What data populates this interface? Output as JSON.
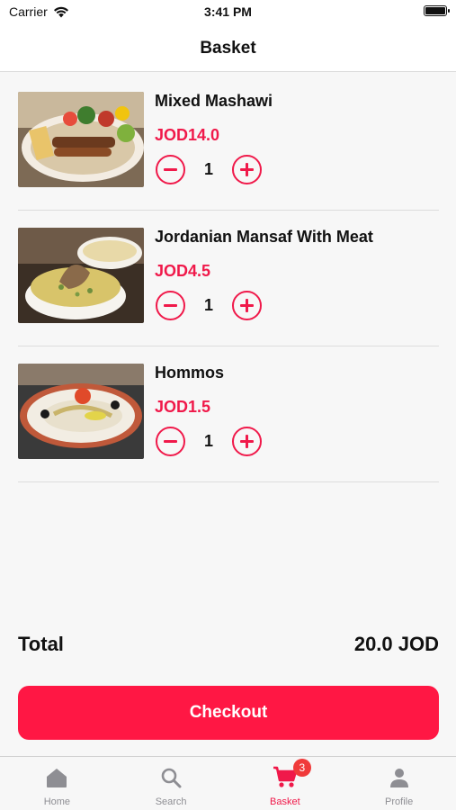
{
  "status_bar": {
    "carrier": "Carrier",
    "time": "3:41 PM"
  },
  "nav": {
    "title": "Basket"
  },
  "items": [
    {
      "name": "Mixed Mashawi",
      "price": "JOD14.0",
      "quantity": "1",
      "image": "mixed-grill-photo"
    },
    {
      "name": "Jordanian Mansaf With Meat",
      "price": "JOD4.5",
      "quantity": "1",
      "image": "mansaf-photo"
    },
    {
      "name": "Hommos",
      "price": "JOD1.5",
      "quantity": "1",
      "image": "hummus-photo"
    }
  ],
  "summary": {
    "total_label": "Total",
    "total_value": "20.0 JOD"
  },
  "checkout": {
    "label": "Checkout"
  },
  "tabs": [
    {
      "label": "Home",
      "icon": "home-icon"
    },
    {
      "label": "Search",
      "icon": "search-icon"
    },
    {
      "label": "Basket",
      "icon": "cart-icon",
      "badge": "3",
      "active": true
    },
    {
      "label": "Profile",
      "icon": "person-icon"
    }
  ],
  "colors": {
    "accent": "#f0194a",
    "checkout_bg": "#ff1744",
    "badge_bg": "#f03a3a",
    "inactive_tab": "#8e8e93"
  }
}
